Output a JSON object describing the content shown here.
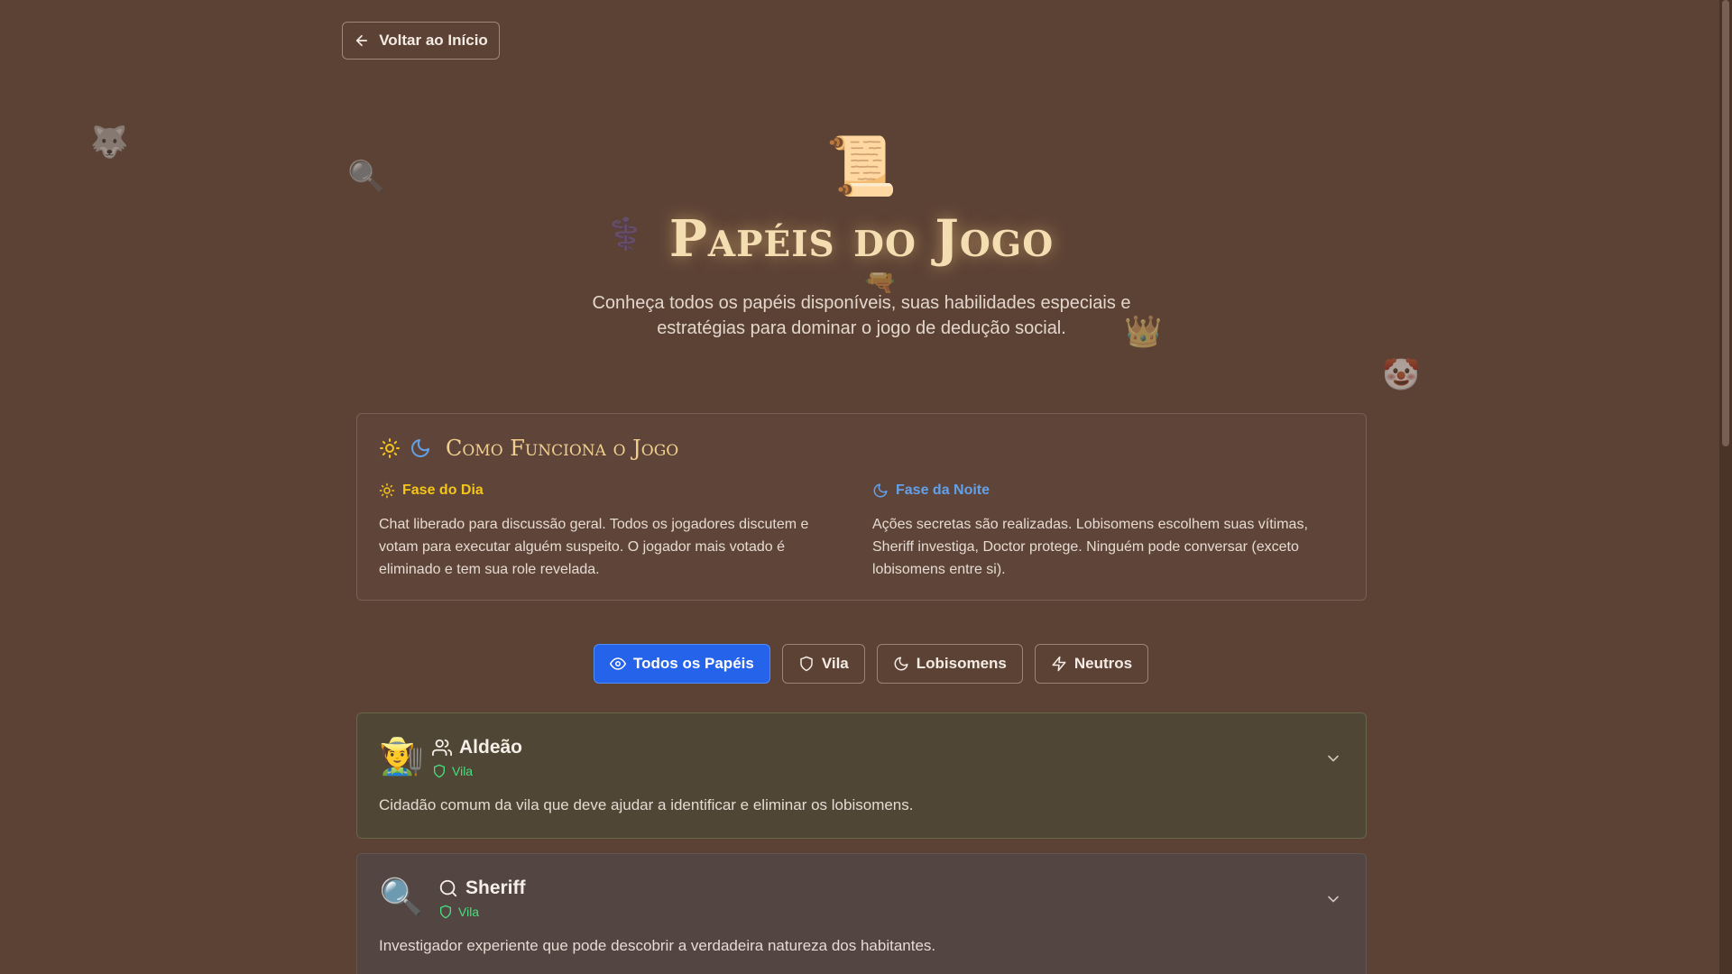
{
  "nav": {
    "back_label": "Voltar ao Início"
  },
  "decorations": {
    "wolf": "🐺",
    "magnifier": "🔍",
    "medical": "⚕️",
    "gun": "🔫",
    "crown": "👑",
    "clown": "🤡",
    "scroll": "📜"
  },
  "header": {
    "title": "Papéis do Jogo",
    "subtitle": "Conheça todos os papéis disponíveis, suas habilidades especiais e estratégias para dominar o jogo de dedução social."
  },
  "how_it_works": {
    "title": "Como Funciona o Jogo",
    "day": {
      "title": "Fase do Dia",
      "text": "Chat liberado para discussão geral. Todos os jogadores discutem e votam para executar alguém suspeito. O jogador mais votado é eliminado e tem sua role revelada."
    },
    "night": {
      "title": "Fase da Noite",
      "text": "Ações secretas são realizadas. Lobisomens escolhem suas vítimas, Sheriff investiga, Doctor protege. Ninguém pode conversar (exceto lobisomens entre si)."
    }
  },
  "filters": [
    {
      "label": "Todos os Papéis",
      "icon": "eye-icon",
      "active": true
    },
    {
      "label": "Vila",
      "icon": "shield-icon",
      "active": false
    },
    {
      "label": "Lobisomens",
      "icon": "moon-icon",
      "active": false
    },
    {
      "label": "Neutros",
      "icon": "zap-icon",
      "active": false
    }
  ],
  "roles": [
    {
      "emoji": "🧑‍🌾",
      "name": "Aldeão",
      "icon": "users-icon",
      "team": "Vila",
      "description": "Cidadão comum da vila que deve ajudar a identificar e eliminar os lobisomens."
    },
    {
      "emoji": "🔍",
      "name": "Sheriff",
      "icon": "search-icon",
      "team": "Vila",
      "description": "Investigador experiente que pode descobrir a verdadeira natureza dos habitantes."
    }
  ],
  "colors": {
    "background": "#5c4235",
    "accent_blue": "#2563eb",
    "day_yellow": "#f5c518",
    "night_blue": "#62a0ea",
    "village_green": "#4ade80",
    "title_gold": "#f4ddb0"
  }
}
